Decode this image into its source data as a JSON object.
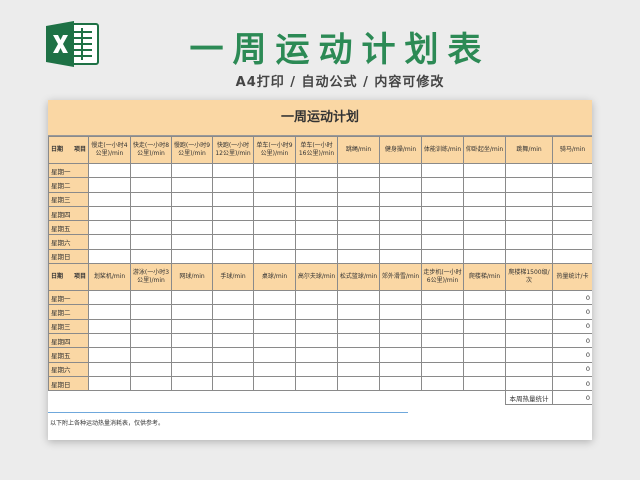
{
  "header": {
    "title": "一周运动计划表",
    "subtitle": "A4打印 / 自动公式 / 内容可修改",
    "logo_icon": "excel-logo-icon",
    "logo_color": "#1e7145"
  },
  "sheet": {
    "title": "一周运动计划",
    "corner_left": "日期",
    "corner_right": "项目",
    "table1_headers": [
      "慢走(一小时4公里)/min",
      "快走(一小时8公里)/min",
      "慢跑(一小时9公里)/min",
      "快跑(一小时12公里)/min",
      "单车(一小时9公里)/min",
      "单车(一小时16公里)/min",
      "跳绳/min",
      "健身操/min",
      "体能训练/min",
      "仰卧起坐/min",
      "跳舞/min",
      "骑马/min"
    ],
    "table2_headers": [
      "划桨机/min",
      "游泳(一小时3公里)/min",
      "网球/min",
      "手球/min",
      "桌球/min",
      "高尔夫球/min",
      "松式篮球/min",
      "郊外滑雪/min",
      "走步机(一小时6公里)/min",
      "爬楼梯/min",
      "爬楼梯1500级/次",
      "热量统计/卡"
    ],
    "days": [
      "星期一",
      "星期二",
      "星期三",
      "星期四",
      "星期五",
      "星期六",
      "星期日"
    ],
    "calorie_values": [
      "0",
      "0",
      "0",
      "0",
      "0",
      "0",
      "0"
    ],
    "weekly_total_label": "本周热量统计",
    "weekly_total_value": "0",
    "footnote": "以下附上各种运动热量消耗表，仅供参考。"
  }
}
